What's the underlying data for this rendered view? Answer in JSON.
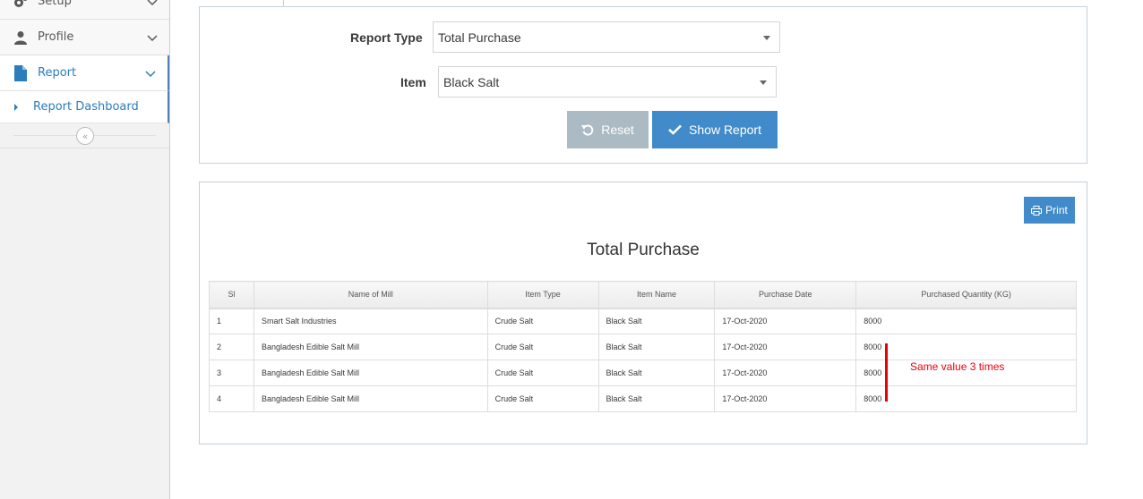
{
  "sidebar": {
    "items": [
      {
        "label": "Setup",
        "icon": "gears-icon"
      },
      {
        "label": "Profile",
        "icon": "user-icon"
      },
      {
        "label": "Report",
        "icon": "file-icon"
      }
    ],
    "subitems": [
      {
        "label": "Report Dashboard"
      }
    ]
  },
  "form": {
    "report_type_label": "Report Type",
    "report_type_value": "Total Purchase",
    "item_label": "Item",
    "item_value": "Black Salt",
    "reset_label": "Reset",
    "show_report_label": "Show Report"
  },
  "report": {
    "print_label": "Print",
    "title": "Total Purchase",
    "columns": [
      "Sl",
      "Name of Mill",
      "Item Type",
      "Item Name",
      "Purchase Date",
      "Purchased Quantity (KG)"
    ],
    "rows": [
      [
        "1",
        "Smart Salt Industries",
        "Crude Salt",
        "Black Salt",
        "17-Oct-2020",
        "8000"
      ],
      [
        "2",
        "Bangladesh Edible Salt Mill",
        "Crude Salt",
        "Black Salt",
        "17-Oct-2020",
        "8000"
      ],
      [
        "3",
        "Bangladesh Edible Salt Mill",
        "Crude Salt",
        "Black Salt",
        "17-Oct-2020",
        "8000"
      ],
      [
        "4",
        "Bangladesh Edible Salt Mill",
        "Crude Salt",
        "Black Salt",
        "17-Oct-2020",
        "8000"
      ]
    ]
  },
  "annotation": {
    "text": "Same value 3 times",
    "color": "#e8000b"
  },
  "colors": {
    "accent": "#428bca",
    "reset": "#abbac3",
    "active_nav": "#2b7dbc"
  }
}
